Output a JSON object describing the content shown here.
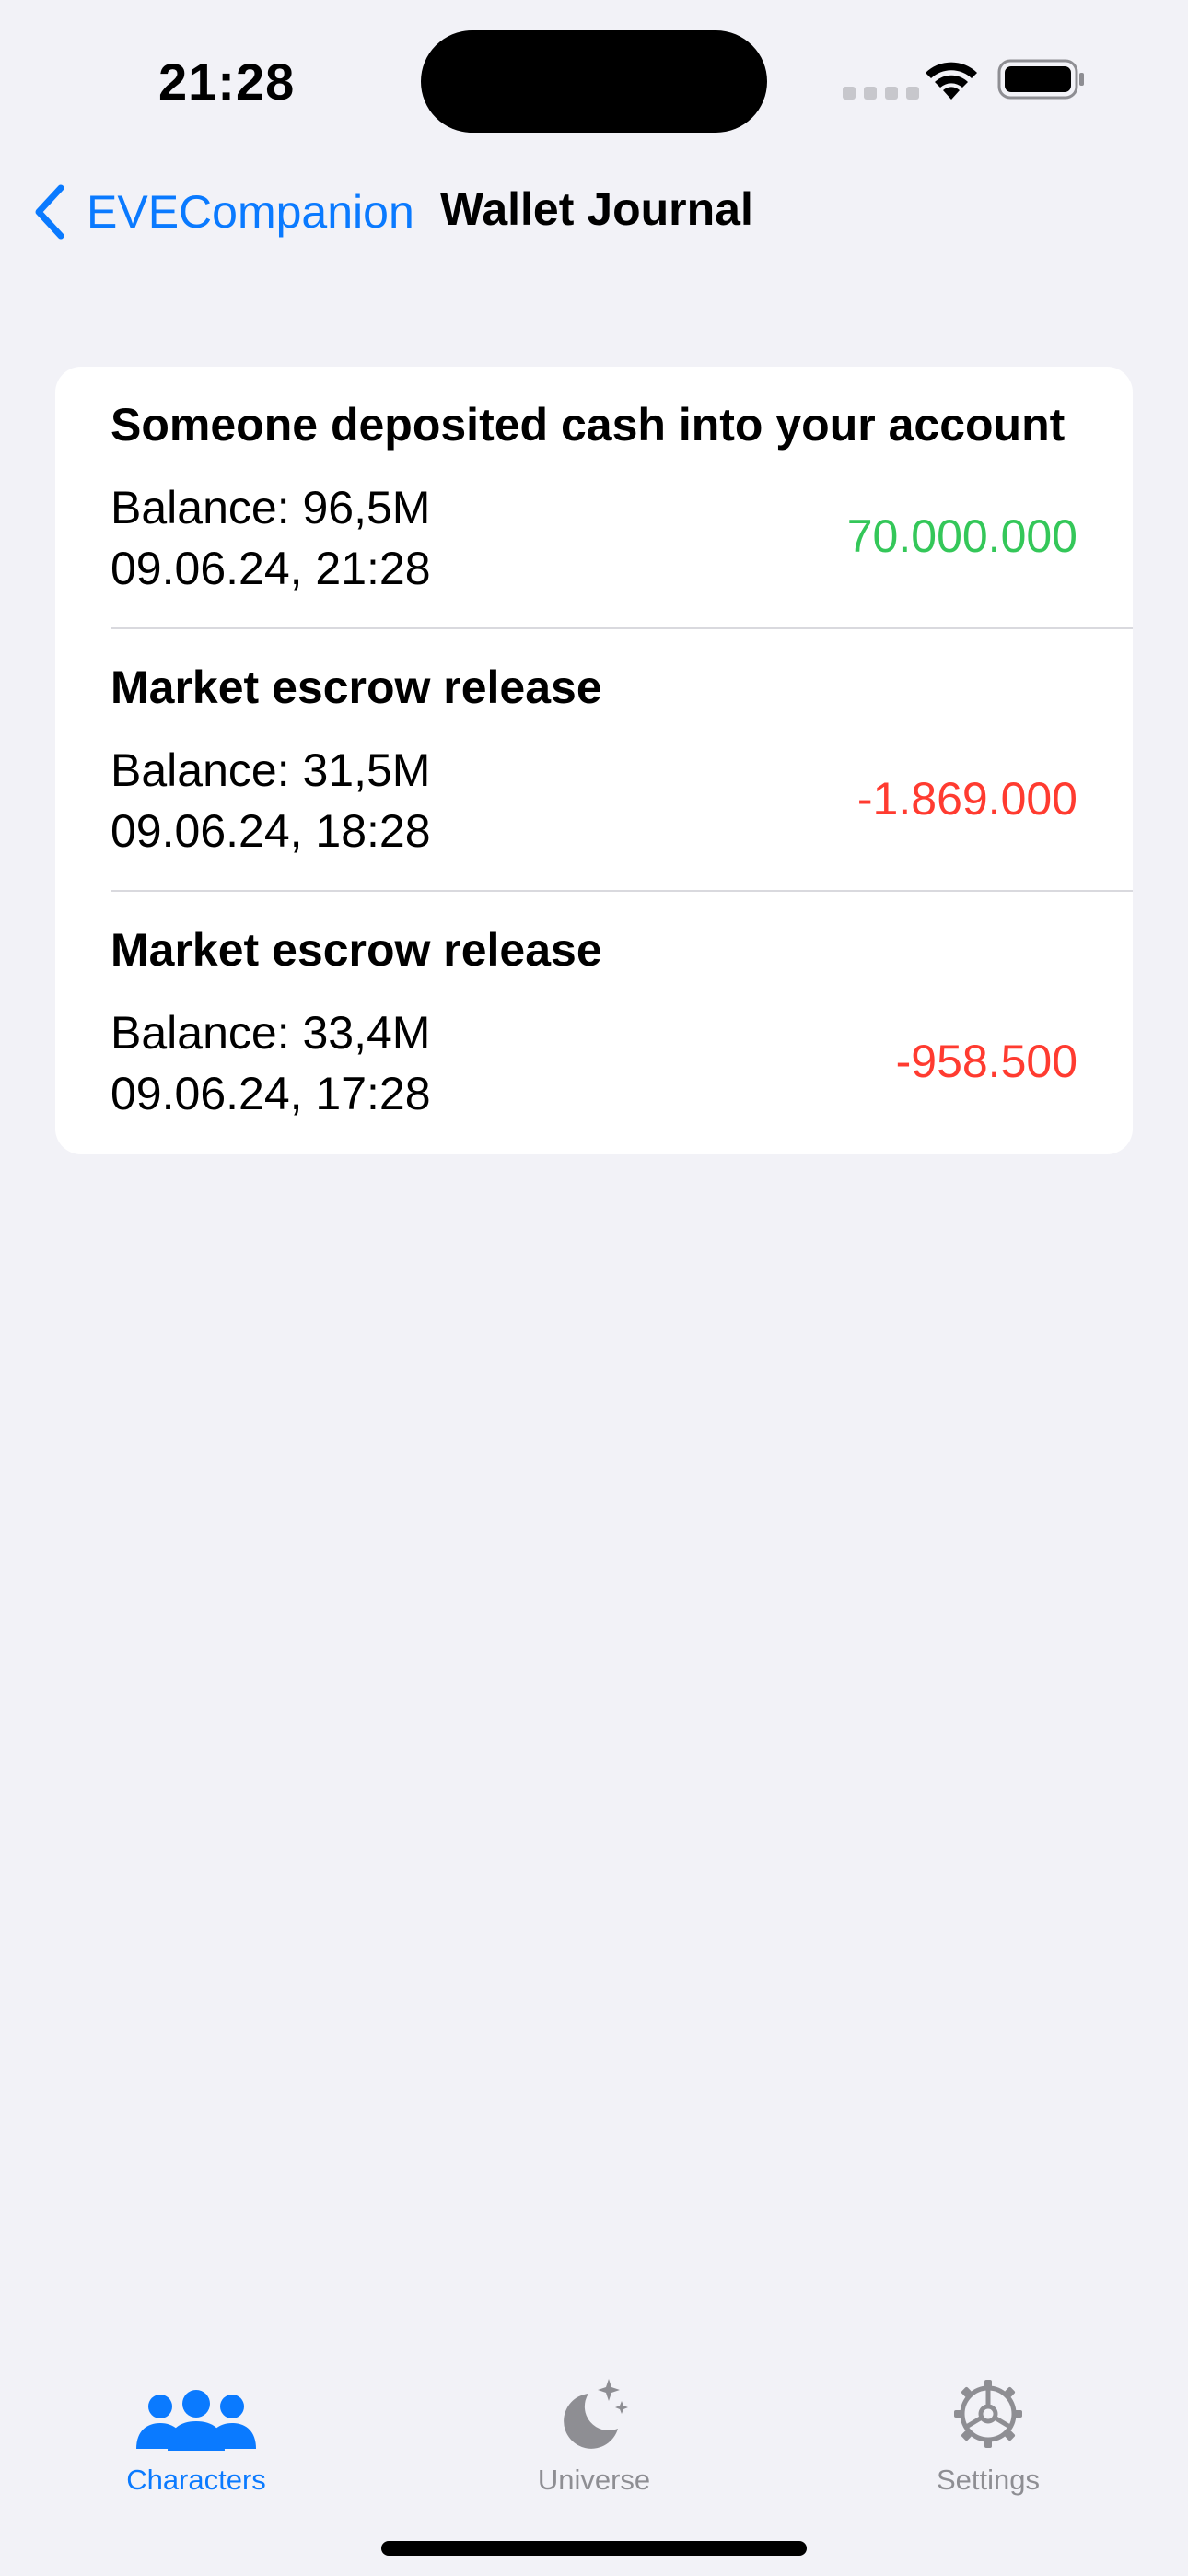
{
  "status_bar": {
    "time": "21:28"
  },
  "nav": {
    "back_label": "EVECompanion",
    "title": "Wallet Journal"
  },
  "journal": {
    "entries": [
      {
        "title": "Someone deposited cash into your account",
        "balance": "Balance: 96,5M",
        "date": "09.06.24, 21:28",
        "amount": "70.000.000",
        "amount_color": "#34C759"
      },
      {
        "title": "Market escrow release",
        "balance": "Balance: 31,5M",
        "date": "09.06.24, 18:28",
        "amount": "-1.869.000",
        "amount_color": "#FF3B30"
      },
      {
        "title": "Market escrow release",
        "balance": "Balance: 33,4M",
        "date": "09.06.24, 17:28",
        "amount": "-958.500",
        "amount_color": "#FF3B30"
      }
    ]
  },
  "tabs": [
    {
      "label": "Characters",
      "icon": "people-icon",
      "selected": true
    },
    {
      "label": "Universe",
      "icon": "moon-stars-icon",
      "selected": false
    },
    {
      "label": "Settings",
      "icon": "gear-icon",
      "selected": false
    }
  ],
  "colors": {
    "accent": "#0A7AFF",
    "inactive": "#8E8E93",
    "positive": "#34C759",
    "negative": "#FF3B30",
    "background": "#F2F2F7"
  }
}
